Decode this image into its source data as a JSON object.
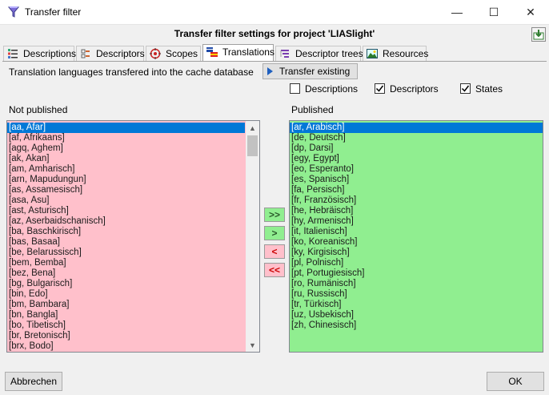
{
  "window": {
    "title": "Transfer filter",
    "minimize": "—",
    "maximize": "☐",
    "close": "✕"
  },
  "header": {
    "title": "Transfer filter settings for project 'LIASlight'"
  },
  "tabs": [
    {
      "label": "Descriptions",
      "icon": "descriptions-icon"
    },
    {
      "label": "Descriptors",
      "icon": "descriptors-icon"
    },
    {
      "label": "Scopes",
      "icon": "scopes-icon"
    },
    {
      "label": "Translations",
      "icon": "translations-icon"
    },
    {
      "label": "Descriptor trees",
      "icon": "descriptor-trees-icon"
    },
    {
      "label": "Resources",
      "icon": "resources-icon"
    }
  ],
  "translations": {
    "info": "Translation languages transfered into the cache database",
    "transfer_button": "Transfer existing",
    "checkboxes": [
      {
        "label": "Descriptions",
        "checked": false
      },
      {
        "label": "Descriptors",
        "checked": true
      },
      {
        "label": "States",
        "checked": true
      }
    ],
    "not_published_label": "Not published",
    "published_label": "Published",
    "not_published": [
      "[aa, Afar]",
      "[af, Afrikaans]",
      "[agq, Aghem]",
      "[ak, Akan]",
      "[am, Amharisch]",
      "[arn, Mapudungun]",
      "[as, Assamesisch]",
      "[asa, Asu]",
      "[ast, Asturisch]",
      "[az, Aserbaidschanisch]",
      "[ba, Baschkirisch]",
      "[bas, Basaa]",
      "[be, Belarussisch]",
      "[bem, Bemba]",
      "[bez, Bena]",
      "[bg, Bulgarisch]",
      "[bin, Edo]",
      "[bm, Bambara]",
      "[bn, Bangla]",
      "[bo, Tibetisch]",
      "[br, Bretonisch]",
      "[brx, Bodo]"
    ],
    "published": [
      "[ar, Arabisch]",
      "[de, Deutsch]",
      "[dp, Darsi]",
      "[egy, Egypt]",
      "[eo, Esperanto]",
      "[es, Spanisch]",
      "[fa, Persisch]",
      "[fr, Französisch]",
      "[he, Hebräisch]",
      "[hy, Armenisch]",
      "[it, Italienisch]",
      "[ko, Koreanisch]",
      "[ky, Kirgisisch]",
      "[pl, Polnisch]",
      "[pt, Portugiesisch]",
      "[ro, Rumänisch]",
      "[ru, Russisch]",
      "[tr, Türkisch]",
      "[uz, Usbekisch]",
      "[zh, Chinesisch]"
    ],
    "move_buttons": {
      "add_all": ">>",
      "add": ">",
      "remove": "<",
      "remove_all": "<<"
    }
  },
  "footer": {
    "cancel": "Abbrechen",
    "ok": "OK"
  },
  "colors": {
    "not_published_bg": "#ffc0cb",
    "published_bg": "#90ee90",
    "selection": "#0078d7"
  }
}
